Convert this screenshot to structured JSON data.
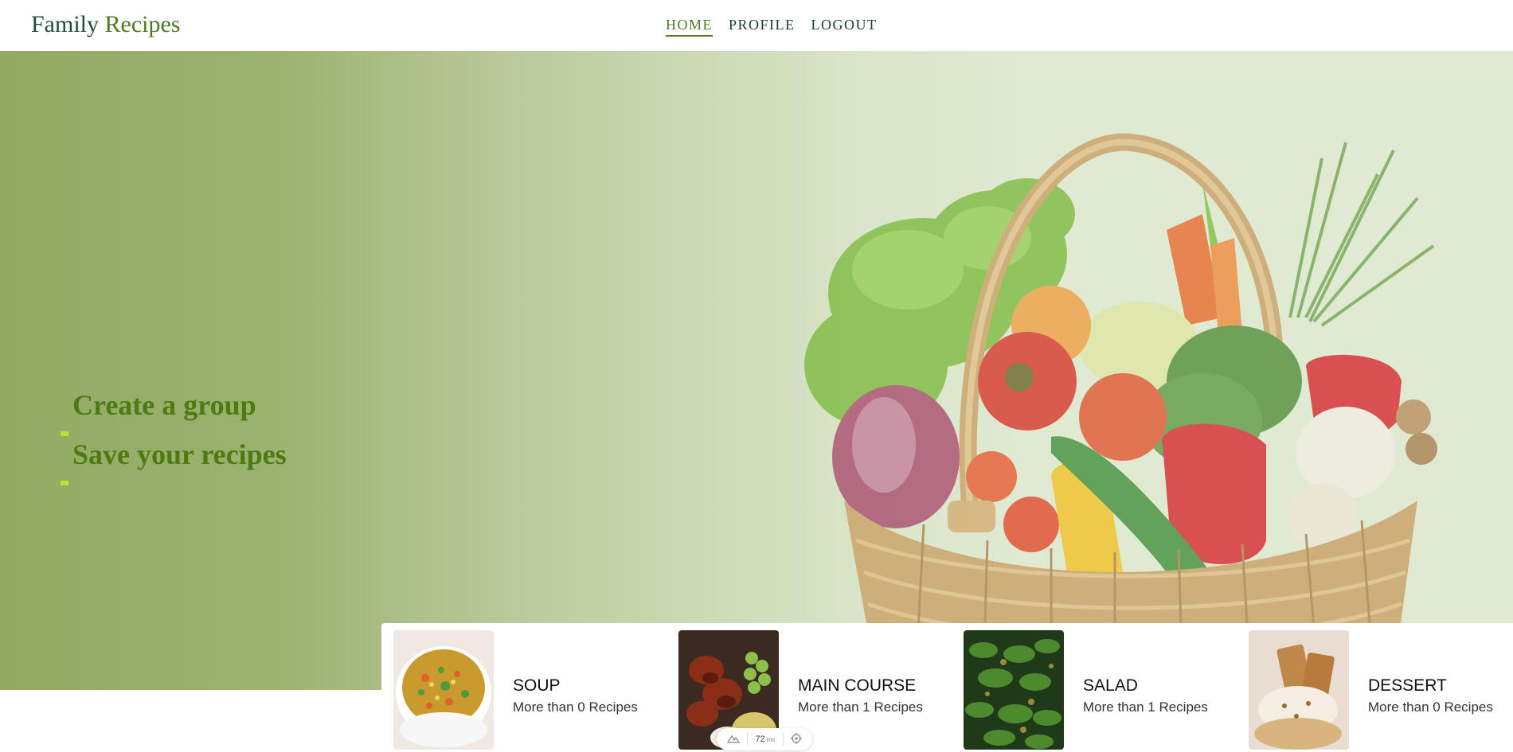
{
  "header": {
    "brand_part1": "Family",
    "brand_part2": "Recipes",
    "nav": [
      {
        "label": "HOME",
        "active": true
      },
      {
        "label": "PROFILE",
        "active": false
      },
      {
        "label": "LOGOUT",
        "active": false
      }
    ]
  },
  "hero": {
    "taglines": [
      "Create a group",
      "Save your recipes"
    ],
    "image_icon": "vegetable-basket-illustration"
  },
  "categories": [
    {
      "title": "SOUP",
      "subtitle": "More than 0 Recipes",
      "icon": "soup-thumbnail"
    },
    {
      "title": "MAIN COURSE",
      "subtitle": "More than 1 Recipes",
      "icon": "main-course-thumbnail"
    },
    {
      "title": "SALAD",
      "subtitle": "More than 1 Recipes",
      "icon": "salad-thumbnail"
    },
    {
      "title": "DESSERT",
      "subtitle": "More than 0 Recipes",
      "icon": "dessert-thumbnail"
    }
  ],
  "dev_toolbar": {
    "timing_value": "72",
    "timing_unit": "ms"
  },
  "colors": {
    "brand_dark": "#1e4d3a",
    "brand_green": "#4a7a1f",
    "accent_active": "#4f7a25",
    "tagline": "#4f7a12",
    "tagline_dash": "#c2e02c",
    "hero_left": "#93aa64",
    "hero_right": "#e0e9d2"
  }
}
